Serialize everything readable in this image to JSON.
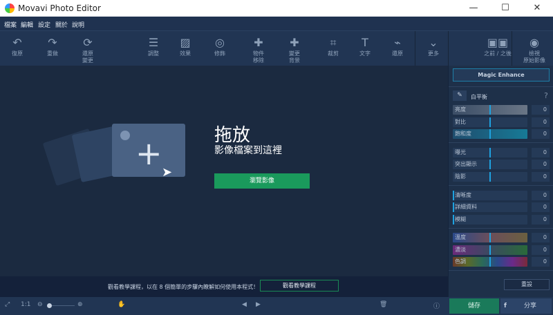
{
  "window": {
    "title": "Movavi Photo Editor",
    "minimize": "—",
    "maximize": "☐",
    "close": "✕"
  },
  "menu": [
    "檔案",
    "編輯",
    "設定",
    "關於",
    "說明"
  ],
  "toolbar": [
    {
      "label": "復原",
      "icon": "undo-icon",
      "glyph": "↶"
    },
    {
      "label": "重做",
      "icon": "redo-icon",
      "glyph": "↷"
    },
    {
      "label": "還原\n變更",
      "icon": "revert-icon",
      "glyph": "⟳"
    },
    {
      "label": "調整",
      "icon": "sliders-icon",
      "glyph": "☰"
    },
    {
      "label": "效果",
      "icon": "effects-icon",
      "glyph": "▨"
    },
    {
      "label": "修飾",
      "icon": "retouch-icon",
      "glyph": "◎"
    },
    {
      "label": "物件\n移除",
      "icon": "object-removal-icon",
      "glyph": "✚"
    },
    {
      "label": "變更\n背景",
      "icon": "background-icon",
      "glyph": "✚"
    },
    {
      "label": "裁剪",
      "icon": "crop-icon",
      "glyph": "⌗"
    },
    {
      "label": "文字",
      "icon": "text-icon",
      "glyph": "T"
    },
    {
      "label": "還原",
      "icon": "restore-icon",
      "glyph": "⌁"
    },
    {
      "label": "更多",
      "icon": "chevron-down-icon",
      "glyph": "⌄"
    },
    {
      "label": "之前 / 之後",
      "icon": "before-after-icon",
      "glyph": "▣▣"
    },
    {
      "label": "檢視\n原始影像",
      "icon": "eye-icon",
      "glyph": "◉"
    }
  ],
  "dropzone": {
    "title": "拖放",
    "subtitle": "影像檔案到這裡",
    "browse": "瀏覽影像"
  },
  "panel": {
    "magic": "Magic Enhance",
    "white_balance": "白平衡",
    "help": "?",
    "groups": [
      [
        {
          "label": "亮度",
          "value": "0"
        },
        {
          "label": "對比",
          "value": "0"
        },
        {
          "label": "飽和度",
          "value": "0"
        }
      ],
      [
        {
          "label": "曝光",
          "value": "0"
        },
        {
          "label": "突出顯示",
          "value": "0"
        },
        {
          "label": "陰影",
          "value": "0"
        }
      ],
      [
        {
          "label": "清晰度",
          "value": "0"
        },
        {
          "label": "詳細資料",
          "value": "0"
        },
        {
          "label": "模糊",
          "value": "0"
        }
      ],
      [
        {
          "label": "溫度",
          "value": "0"
        },
        {
          "label": "濃淡",
          "value": "0"
        },
        {
          "label": "色調",
          "value": "0"
        }
      ]
    ],
    "reset": "重設",
    "save": "儲存",
    "share": "分享"
  },
  "tips": {
    "text": "觀看教學課程，以在 8 個簡單的步驟內瞭解如何使用本程式！",
    "button": "觀看教學課程"
  },
  "bottom": {
    "ratio": "1:1"
  },
  "colors": {
    "accent_green": "#1a9a5c",
    "accent_blue": "#1ea2e0"
  }
}
